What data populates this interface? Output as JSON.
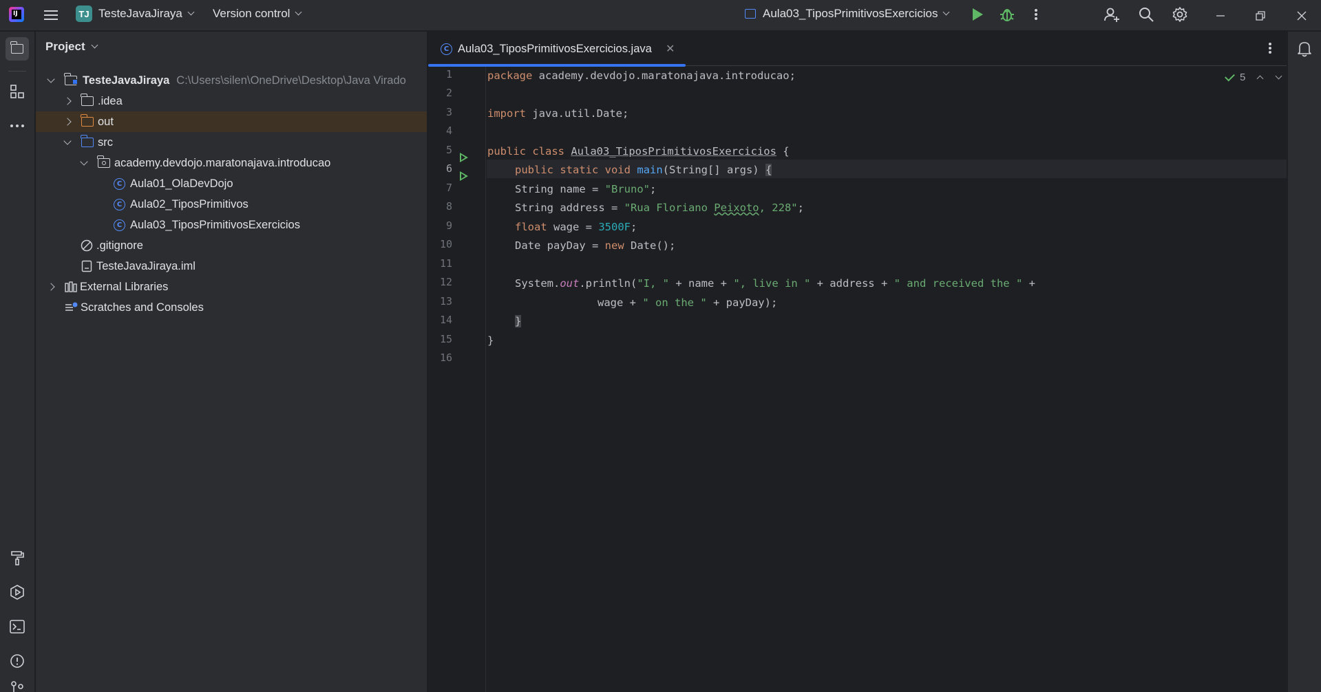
{
  "titlebar": {
    "logo_text": "IJ",
    "project_badge": "TJ",
    "project_name": "TesteJavaJiraya",
    "vcs_label": "Version control",
    "run_config": "Aula03_TiposPrimitivosExercicios"
  },
  "project_panel": {
    "title": "Project",
    "root_name": "TesteJavaJiraya",
    "root_path": "C:\\Users\\silen\\OneDrive\\Desktop\\Java Virado",
    "items": [
      {
        "label": ".idea"
      },
      {
        "label": "out"
      },
      {
        "label": "src"
      },
      {
        "label": "academy.devdojo.maratonajava.introducao"
      },
      {
        "label": "Aula01_OlaDevDojo"
      },
      {
        "label": "Aula02_TiposPrimitivos"
      },
      {
        "label": "Aula03_TiposPrimitivosExercicios"
      },
      {
        "label": ".gitignore"
      },
      {
        "label": "TesteJavaJiraya.iml"
      },
      {
        "label": "External Libraries"
      },
      {
        "label": "Scratches and Consoles"
      }
    ]
  },
  "editor": {
    "tab_title": "Aula03_TiposPrimitivosExercicios.java",
    "inspection_count": "5",
    "line_numbers": [
      "1",
      "2",
      "3",
      "4",
      "5",
      "6",
      "7",
      "8",
      "9",
      "10",
      "11",
      "12",
      "13",
      "14",
      "15",
      "16"
    ],
    "current_line": "6",
    "code": {
      "l1_kw": "package",
      "l1_rest": " academy.devdojo.maratonajava.introducao;",
      "l3_kw": "import",
      "l3_rest": " java.util.Date;",
      "l5_kw": "public class",
      "l5_name": "Aula03_TiposPrimitivosExercicios",
      "l5_rest": " {",
      "l6_kw": "public static void",
      "l6_fn": "main",
      "l6_rest": "(String[] args) ",
      "l6_brace": "{",
      "l7_a": "String name = ",
      "l7_str": "\"Bruno\"",
      "l7_b": ";",
      "l8_a": "String address = ",
      "l8_str1": "\"Rua Floriano ",
      "l8_typo": "Peixoto",
      "l8_str2": ", 228\"",
      "l8_b": ";",
      "l9_kw": "float",
      "l9_a": " wage = ",
      "l9_num": "3500F",
      "l9_b": ";",
      "l10_a": "Date payDay = ",
      "l10_kw": "new",
      "l10_b": " Date();",
      "l12_a": "System.",
      "l12_static": "out",
      "l12_b": ".println(",
      "l12_s1": "\"I, \"",
      "l12_c": " + name + ",
      "l12_s2": "\", live in \"",
      "l12_d": " + address + ",
      "l12_s3": "\" and received the \"",
      "l12_e": " +",
      "l13_a": "wage + ",
      "l13_s": "\" on the \"",
      "l13_b": " + payDay);",
      "l14_brace": "}",
      "l15": "}"
    }
  },
  "colors": {
    "accent": "#3574f0",
    "run_green": "#5fb865",
    "keyword": "#cf8e6d",
    "string": "#6aab73",
    "number": "#2aacb8",
    "function": "#56a8f5"
  }
}
